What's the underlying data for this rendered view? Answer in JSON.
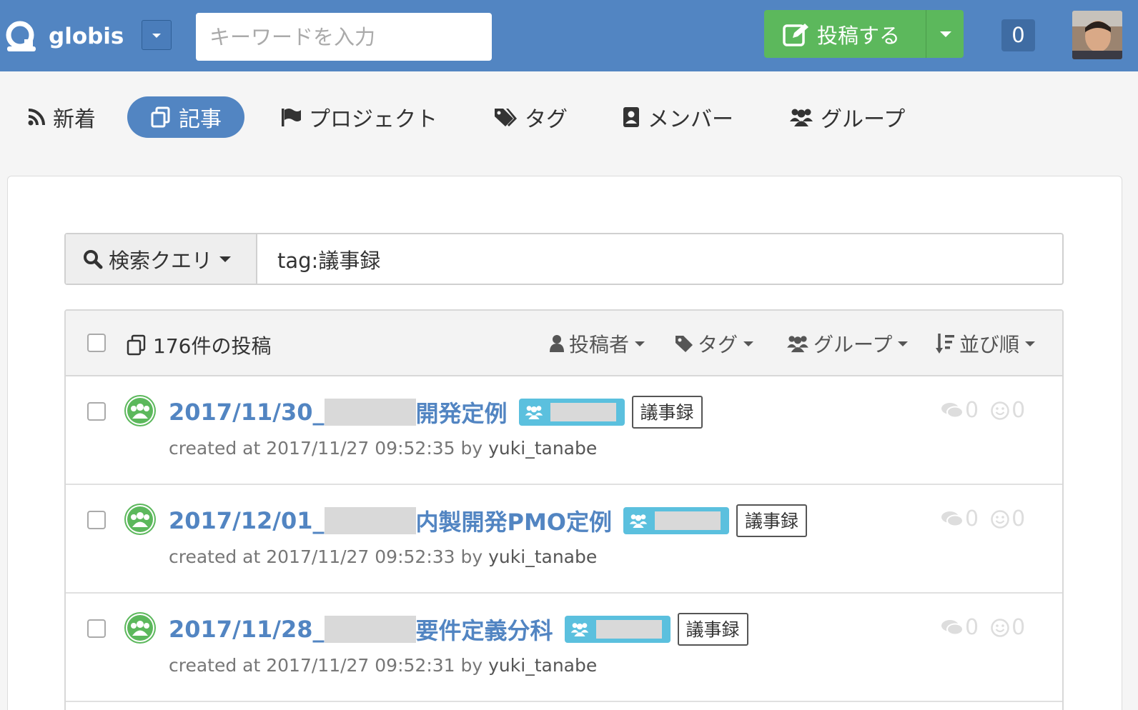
{
  "header": {
    "app_name": "globis",
    "search_placeholder": "キーワードを入力",
    "post_button_label": "投稿する",
    "notification_count": "0",
    "brand_color": "#5285c2",
    "post_color": "#5cb85c"
  },
  "nav": {
    "items": [
      {
        "label": "新着",
        "icon": "rss-icon"
      },
      {
        "label": "記事",
        "icon": "documents-icon",
        "active": true
      },
      {
        "label": "プロジェクト",
        "icon": "flag-icon"
      },
      {
        "label": "タグ",
        "icon": "tags-icon"
      },
      {
        "label": "メンバー",
        "icon": "address-book-icon"
      },
      {
        "label": "グループ",
        "icon": "users-icon"
      }
    ]
  },
  "query": {
    "button_label": "検索クエリ",
    "value": "tag:議事録"
  },
  "list": {
    "count_label": "176件の投稿",
    "filters": [
      {
        "label": "投稿者",
        "icon": "user-icon"
      },
      {
        "label": "タグ",
        "icon": "tag-icon"
      },
      {
        "label": "グループ",
        "icon": "users-icon"
      },
      {
        "label": "並び順",
        "icon": "sort-icon"
      }
    ],
    "posts": [
      {
        "title_prefix": "2017/11/30_",
        "title_suffix": "開発定例",
        "tag": "議事録",
        "meta_prefix": "created at 2017/11/27 09:52:35 by",
        "author": "yuki_tanabe",
        "comments": "0",
        "reactions": "0"
      },
      {
        "title_prefix": "2017/12/01_",
        "title_suffix": "内製開発PMO定例",
        "tag": "議事録",
        "meta_prefix": "created at 2017/11/27 09:52:33 by",
        "author": "yuki_tanabe",
        "comments": "0",
        "reactions": "0"
      },
      {
        "title_prefix": "2017/11/28_",
        "title_suffix": "要件定義分科",
        "tag": "議事録",
        "meta_prefix": "created at 2017/11/27 09:52:31 by",
        "author": "yuki_tanabe",
        "comments": "0",
        "reactions": "0"
      }
    ]
  }
}
